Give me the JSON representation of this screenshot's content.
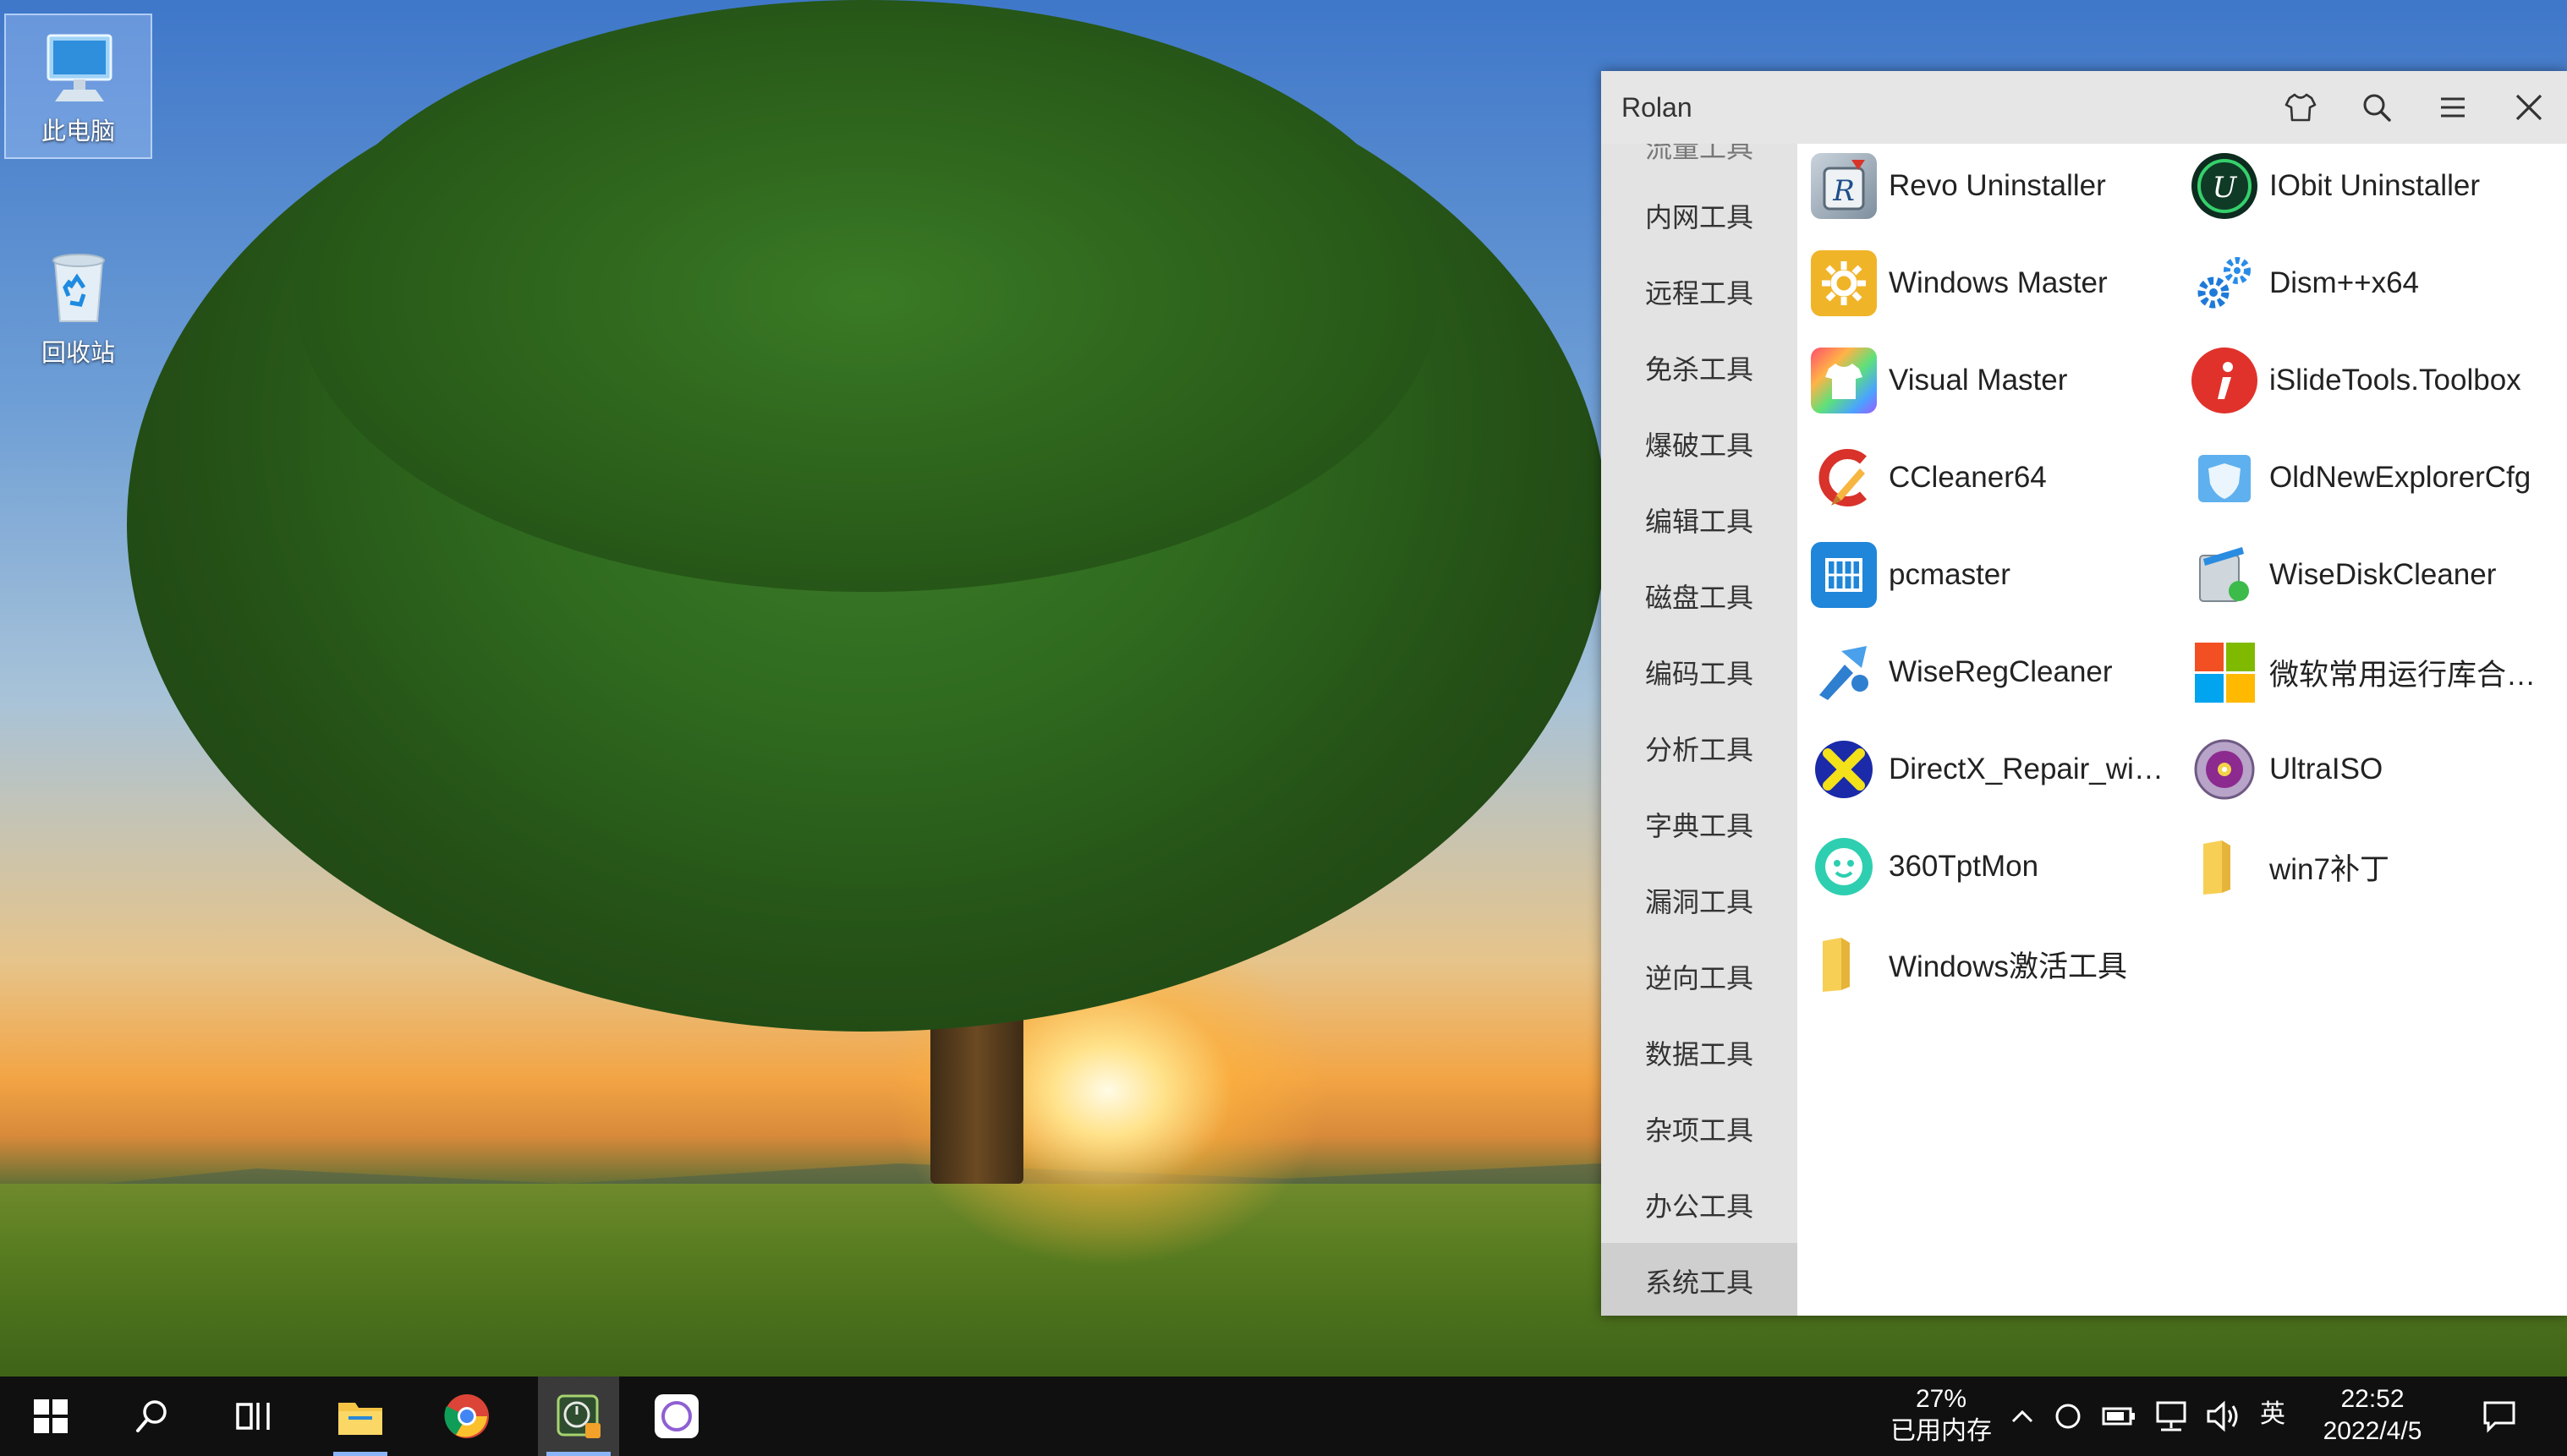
{
  "desktop": {
    "icons": [
      {
        "label": "此电脑"
      },
      {
        "label": "回收站"
      }
    ]
  },
  "rolan": {
    "title": "Rolan",
    "sidebar": {
      "partial_top": "流量工具",
      "items": [
        "内网工具",
        "远程工具",
        "免杀工具",
        "爆破工具",
        "编辑工具",
        "磁盘工具",
        "编码工具",
        "分析工具",
        "字典工具",
        "漏洞工具",
        "逆向工具",
        "数据工具",
        "杂项工具",
        "办公工具",
        "系统工具"
      ],
      "active": "系统工具"
    },
    "apps": [
      {
        "label": "Revo Uninstaller",
        "icon": "revo-uninstaller-icon"
      },
      {
        "label": "IObit Uninstaller",
        "icon": "iobit-uninstaller-icon"
      },
      {
        "label": "Windows Master",
        "icon": "windows-master-icon"
      },
      {
        "label": "Dism++x64",
        "icon": "dism-icon"
      },
      {
        "label": "Visual Master",
        "icon": "visual-master-icon"
      },
      {
        "label": "iSlideTools.Toolbox",
        "icon": "islide-icon"
      },
      {
        "label": "CCleaner64",
        "icon": "ccleaner-icon"
      },
      {
        "label": "OldNewExplorerCfg",
        "icon": "oldnewexplorer-icon"
      },
      {
        "label": "pcmaster",
        "icon": "pcmaster-icon"
      },
      {
        "label": "WiseDiskCleaner",
        "icon": "wisediskcleaner-icon"
      },
      {
        "label": "WiseRegCleaner",
        "icon": "wiseregcleaner-icon"
      },
      {
        "label": "微软常用运行库合集...",
        "icon": "microsoft-runtime-icon"
      },
      {
        "label": "DirectX_Repair_win...",
        "icon": "directx-repair-icon"
      },
      {
        "label": "UltraISO",
        "icon": "ultraiso-icon"
      },
      {
        "label": "360TptMon",
        "icon": "360tptmon-icon"
      },
      {
        "label": "win7补丁",
        "icon": "folder-icon"
      },
      {
        "label": "Windows激活工具",
        "icon": "folder-icon"
      }
    ]
  },
  "taskbar": {
    "memory_percent": "27%",
    "memory_label": "已用内存",
    "ime": "英",
    "time": "22:52",
    "date": "2022/4/5"
  },
  "colors": {
    "taskbar": "#101010",
    "accent": "#8ab4f8"
  }
}
